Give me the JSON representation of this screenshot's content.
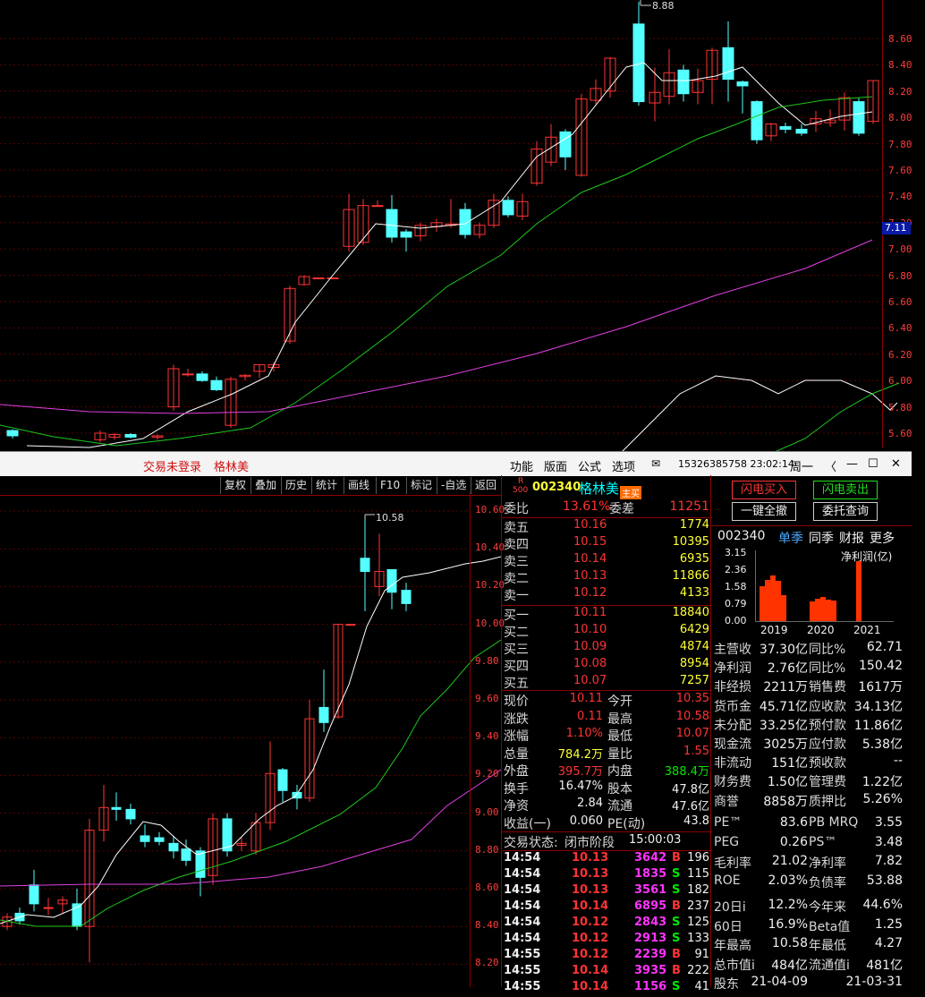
{
  "bg_chart": {
    "price_ticks": [
      "8.60",
      "8.40",
      "8.20",
      "8.00",
      "7.80",
      "7.60",
      "7.40",
      "7.20",
      "7.00",
      "6.80",
      "6.60",
      "6.40",
      "6.20",
      "6.00",
      "5.80",
      "5.60"
    ],
    "current_price": "7.11",
    "high_label": "8.88"
  },
  "window": {
    "login": "交易未登录",
    "stock_name": "格林美",
    "menu": [
      "功能",
      "版面",
      "公式",
      "选项"
    ],
    "phone_time": "15326385758 23:02:14",
    "week": "周一"
  },
  "toolbar": [
    "复权",
    "叠加",
    "历史",
    "统计",
    "画线",
    "F10",
    "标记",
    "-自选",
    "返回"
  ],
  "chart2": {
    "price_ticks": [
      "10.60",
      "10.40",
      "10.20",
      "10.00",
      "9.80",
      "9.60",
      "9.40",
      "9.20",
      "9.00",
      "8.80",
      "8.60",
      "8.40",
      "8.20"
    ],
    "high_label": "10.58"
  },
  "quote": {
    "header": {
      "badge_r": "R",
      "badge_500": "500",
      "code": "002340",
      "name": "格林美",
      "tag": "主买"
    },
    "weibi": {
      "label": "委比",
      "value": "13.61%",
      "label2": "委差",
      "value2": "11251"
    },
    "asks": [
      {
        "label": "卖五",
        "price": "10.16",
        "vol": "1774"
      },
      {
        "label": "卖四",
        "price": "10.15",
        "vol": "10395"
      },
      {
        "label": "卖三",
        "price": "10.14",
        "vol": "6935"
      },
      {
        "label": "卖二",
        "price": "10.13",
        "vol": "11866"
      },
      {
        "label": "卖一",
        "price": "10.12",
        "vol": "4133"
      }
    ],
    "bids": [
      {
        "label": "买一",
        "price": "10.11",
        "vol": "18840"
      },
      {
        "label": "买二",
        "price": "10.10",
        "vol": "6429"
      },
      {
        "label": "买三",
        "price": "10.09",
        "vol": "4874"
      },
      {
        "label": "买四",
        "price": "10.08",
        "vol": "8954"
      },
      {
        "label": "买五",
        "price": "10.07",
        "vol": "7257"
      }
    ],
    "stats": [
      {
        "l1": "现价",
        "v1": "10.11",
        "l2": "今开",
        "v2": "10.35",
        "c1": "red",
        "c2": "red"
      },
      {
        "l1": "涨跌",
        "v1": "0.11",
        "l2": "最高",
        "v2": "10.58",
        "c1": "red",
        "c2": "red"
      },
      {
        "l1": "涨幅",
        "v1": "1.10%",
        "l2": "最低",
        "v2": "10.07",
        "c1": "red",
        "c2": "red"
      },
      {
        "l1": "总量",
        "v1": "784.2万",
        "l2": "量比",
        "v2": "1.55",
        "c1": "yel",
        "c2": "red"
      },
      {
        "l1": "外盘",
        "v1": "395.7万",
        "l2": "内盘",
        "v2": "388.4万",
        "c1": "red",
        "c2": "grn"
      },
      {
        "l1": "换手",
        "v1": "16.47%",
        "l2": "股本",
        "v2": "47.8亿",
        "c1": "wht",
        "c2": "wht"
      },
      {
        "l1": "净资",
        "v1": "2.84",
        "l2": "流通",
        "v2": "47.6亿",
        "c1": "wht",
        "c2": "wht"
      },
      {
        "l1": "收益(一)",
        "v1": "0.060",
        "l2": "PE(动)",
        "v2": "43.8",
        "c1": "wht",
        "c2": "wht"
      }
    ],
    "status": {
      "label": "交易状态:",
      "value": "闭市阶段",
      "time": "15:00:03"
    },
    "ticks": [
      {
        "time": "14:54",
        "price": "10.13",
        "vol": "3642",
        "side": "B",
        "n": "196"
      },
      {
        "time": "14:54",
        "price": "10.13",
        "vol": "1835",
        "side": "S",
        "n": "115"
      },
      {
        "time": "14:54",
        "price": "10.13",
        "vol": "3561",
        "side": "S",
        "n": "182"
      },
      {
        "time": "14:54",
        "price": "10.14",
        "vol": "6895",
        "side": "B",
        "n": "237"
      },
      {
        "time": "14:54",
        "price": "10.12",
        "vol": "2843",
        "side": "S",
        "n": "125"
      },
      {
        "time": "14:54",
        "price": "10.12",
        "vol": "2913",
        "side": "S",
        "n": "133"
      },
      {
        "time": "14:55",
        "price": "10.12",
        "vol": "2239",
        "side": "B",
        "n": "91"
      },
      {
        "time": "14:55",
        "price": "10.14",
        "vol": "3935",
        "side": "B",
        "n": "222"
      },
      {
        "time": "14:55",
        "price": "10.14",
        "vol": "1156",
        "side": "S",
        "n": "41"
      }
    ]
  },
  "finance": {
    "buttons": {
      "flash_buy": "闪电买入",
      "flash_sell": "闪电卖出",
      "cancel_all": "一键全撤",
      "query": "委托查询"
    },
    "header": {
      "code": "002340",
      "tabs": [
        "单季",
        "同季",
        "财报",
        "更多"
      ]
    },
    "chart_title": "净利润(亿)",
    "yticks": [
      "3.15",
      "2.36",
      "1.58",
      "0.79",
      "0.00"
    ],
    "years": [
      "2019",
      "2020",
      "2021"
    ],
    "bars": [
      1.6,
      1.9,
      2.1,
      1.85,
      1.2,
      0.9,
      1.05,
      1.1,
      1.0,
      0.95,
      2.76
    ],
    "rows": [
      {
        "l1": "主营收",
        "v1": "37.30亿",
        "l2": "同比%",
        "v2": "62.71"
      },
      {
        "l1": "净利润",
        "v1": "2.76亿",
        "l2": "同比%",
        "v2": "150.42"
      },
      {
        "l1": "非经损",
        "v1": "2211万",
        "l2": "销售费",
        "v2": "1617万"
      },
      {
        "l1": "货币金",
        "v1": "45.71亿",
        "l2": "应收款",
        "v2": "34.13亿"
      },
      {
        "l1": "未分配",
        "v1": "33.25亿",
        "l2": "预付款",
        "v2": "11.86亿"
      },
      {
        "l1": "现金流",
        "v1": "3025万",
        "l2": "应付款",
        "v2": "5.38亿"
      },
      {
        "l1": "非流动",
        "v1": "151亿",
        "l2": "预收款",
        "v2": "--"
      },
      {
        "l1": "财务费",
        "v1": "1.50亿",
        "l2": "管理费",
        "v2": "1.22亿"
      },
      {
        "l1": "商誉",
        "v1": "8858万",
        "l2": "质押比",
        "v2": "5.26%"
      }
    ],
    "rows2": [
      {
        "l1": "PE™",
        "v1": "83.6",
        "l2": "PB MRQ",
        "v2": "3.55"
      },
      {
        "l1": "PEG",
        "v1": "0.26",
        "l2": "PS™",
        "v2": "3.48"
      },
      {
        "l1": "毛利率",
        "v1": "21.02",
        "l2": "净利率",
        "v2": "7.82"
      },
      {
        "l1": "ROE",
        "v1": "2.03%",
        "l2": "负债率",
        "v2": "53.88"
      }
    ],
    "rows3": [
      {
        "l1": "20日i",
        "v1": "12.2%",
        "l2": "今年来",
        "v2": "44.6%"
      },
      {
        "l1": "60日",
        "v1": "16.9%",
        "l2": "Beta值",
        "v2": "1.25"
      },
      {
        "l1": "年最高",
        "v1": "10.58",
        "l2": "年最低",
        "v2": "4.27"
      },
      {
        "l1": "总市值i",
        "v1": "484亿",
        "l2": "流通值i",
        "v2": "481亿"
      },
      {
        "l1": "股东",
        "v1": "21-04-09",
        "l2": "",
        "v2": "21-03-31"
      }
    ]
  },
  "colors": {
    "up": "#ff3333",
    "down": "#54ffff",
    "ma5": "#ffffff",
    "ma10": "#1cc81c",
    "ma20": "#e040e0"
  }
}
